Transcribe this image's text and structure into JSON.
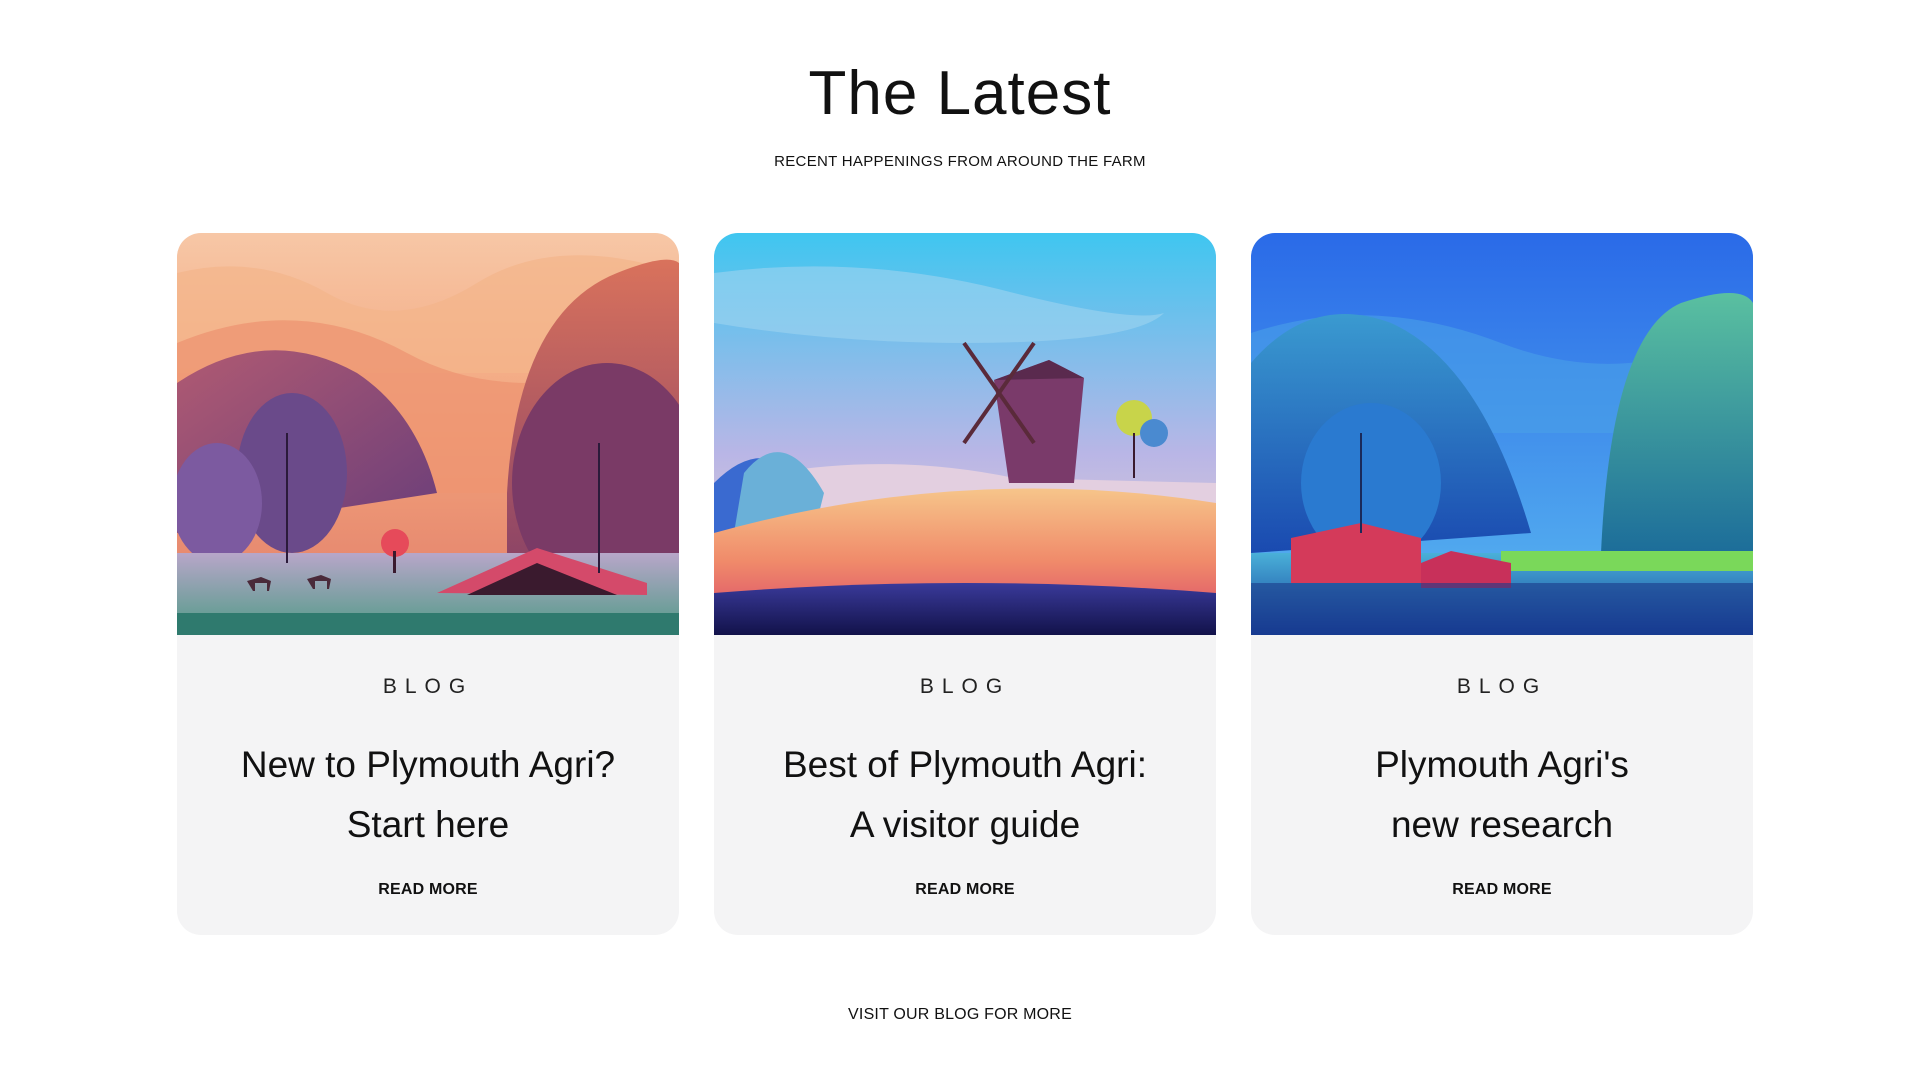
{
  "section": {
    "title": "The Latest",
    "subtitle": "RECENT HAPPENINGS FROM AROUND THE FARM"
  },
  "cards": [
    {
      "category": "BLOG",
      "title_line1": "New to Plymouth Agri?",
      "title_line2": "Start here",
      "link": "READ MORE",
      "image": "sunset-farm-illustration"
    },
    {
      "category": "BLOG",
      "title_line1": "Best of Plymouth Agri:",
      "title_line2": "A visitor guide",
      "link": "READ MORE",
      "image": "windmill-illustration"
    },
    {
      "category": "BLOG",
      "title_line1": "Plymouth Agri's",
      "title_line2": "new research",
      "link": "READ MORE",
      "image": "lake-barn-illustration"
    }
  ],
  "footer_link": "VISIT OUR BLOG FOR MORE",
  "colors": {
    "card_background": "#f4f4f5",
    "text": "#111111"
  }
}
